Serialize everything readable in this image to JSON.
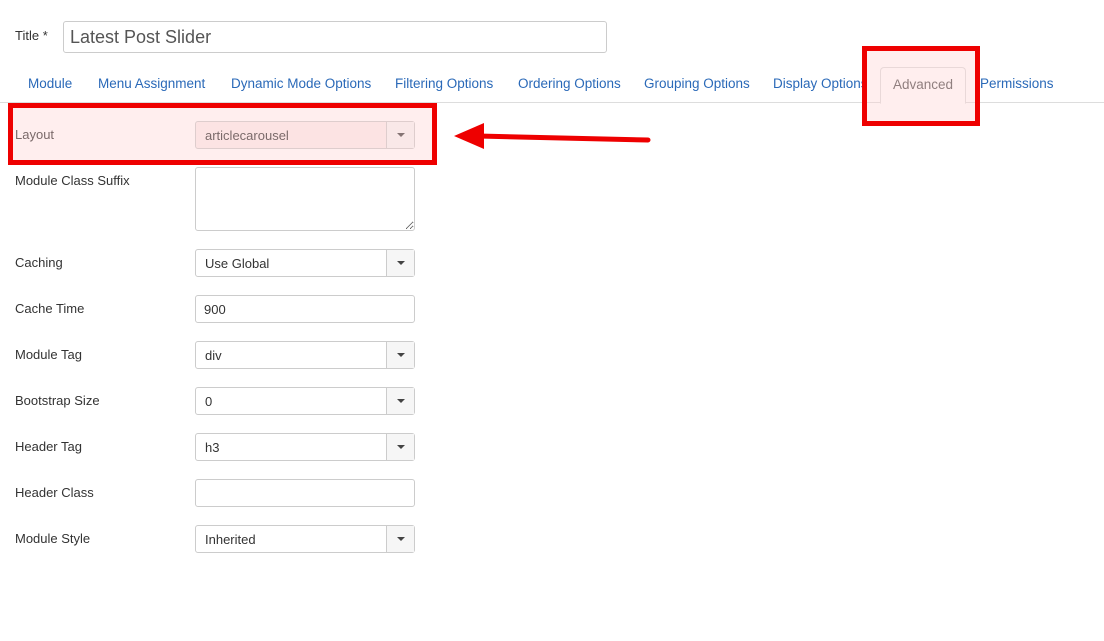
{
  "title": {
    "label": "Title *",
    "value": "Latest Post Slider"
  },
  "tabs": [
    {
      "label": "Module"
    },
    {
      "label": "Menu Assignment"
    },
    {
      "label": "Dynamic Mode Options"
    },
    {
      "label": "Filtering Options"
    },
    {
      "label": "Ordering Options"
    },
    {
      "label": "Grouping Options"
    },
    {
      "label": "Display Options"
    },
    {
      "label": "Advanced",
      "active": true
    },
    {
      "label": "Permissions"
    }
  ],
  "fields": {
    "layout": {
      "label": "Layout",
      "value": "articlecarousel"
    },
    "module_class_suffix": {
      "label": "Module Class Suffix",
      "value": ""
    },
    "caching": {
      "label": "Caching",
      "value": "Use Global"
    },
    "cache_time": {
      "label": "Cache Time",
      "value": "900"
    },
    "module_tag": {
      "label": "Module Tag",
      "value": "div"
    },
    "bootstrap_size": {
      "label": "Bootstrap Size",
      "value": "0"
    },
    "header_tag": {
      "label": "Header Tag",
      "value": "h3"
    },
    "header_class": {
      "label": "Header Class",
      "value": ""
    },
    "module_style": {
      "label": "Module Style",
      "value": "Inherited"
    }
  },
  "annotations": {
    "highlight_color": "#ee0000",
    "arrow_color": "#ee0000"
  }
}
